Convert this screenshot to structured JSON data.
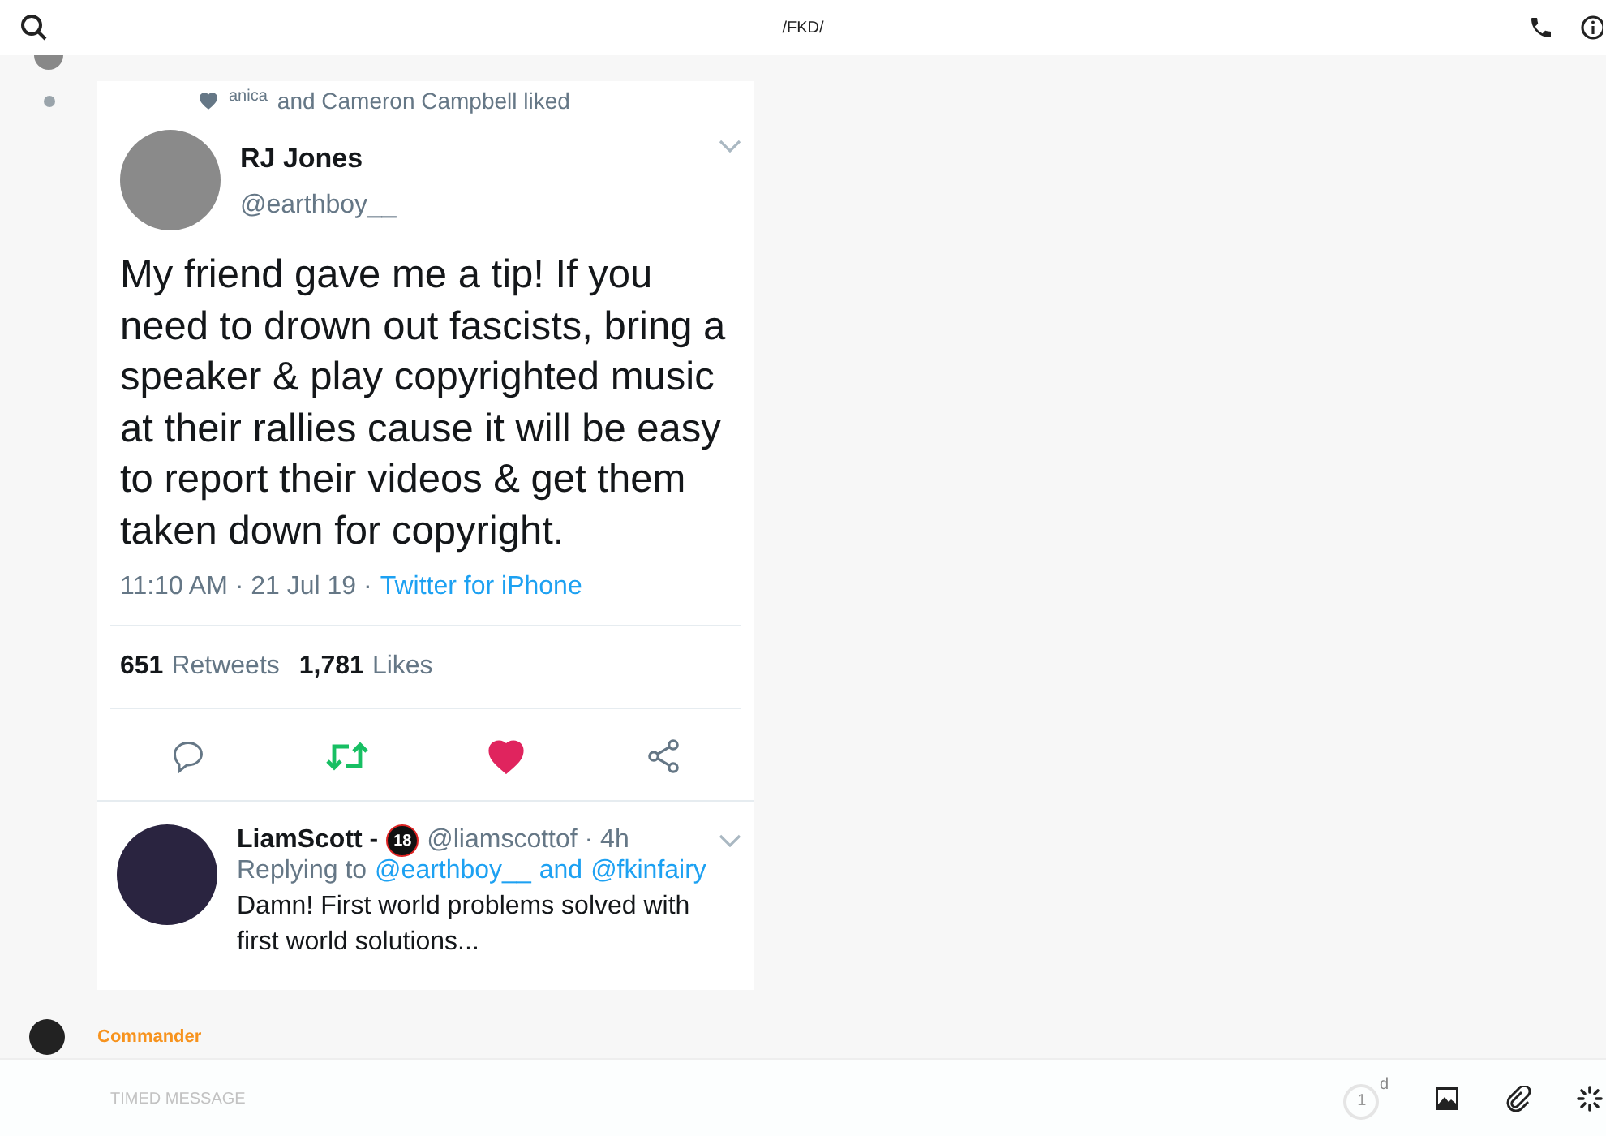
{
  "header": {
    "title": "/FKD/"
  },
  "tweet": {
    "liked_by": "anica",
    "liked_suffix": "and Cameron Campbell liked",
    "author": "RJ Jones",
    "handle": "@earthboy__",
    "text": "My friend gave me a tip! If you need to drown out fascists, bring a speaker & play copyrighted music at their rallies cause it will be easy to report their videos & get them taken down for copyright.",
    "time": "11:10 AM · 21 Jul 19 ·",
    "source": "Twitter for iPhone",
    "retweets": "651",
    "retweets_label": "Retweets",
    "likes": "1,781",
    "likes_label": "Likes",
    "retweeted": true,
    "liked": true
  },
  "reply": {
    "name": "LiamScott -",
    "badge": "18",
    "handle_time": "@liamscottof · 4h",
    "replying": "Replying to",
    "mention_1": "@earthboy__",
    "conjunction": "and",
    "mention_2": "@fkinfairy",
    "text": "Damn! First world problems solved with first world solutions..."
  },
  "next_sender": "Commander",
  "composer": {
    "placeholder": "TIMED MESSAGE",
    "timer": "1",
    "timer_unit": "d"
  }
}
